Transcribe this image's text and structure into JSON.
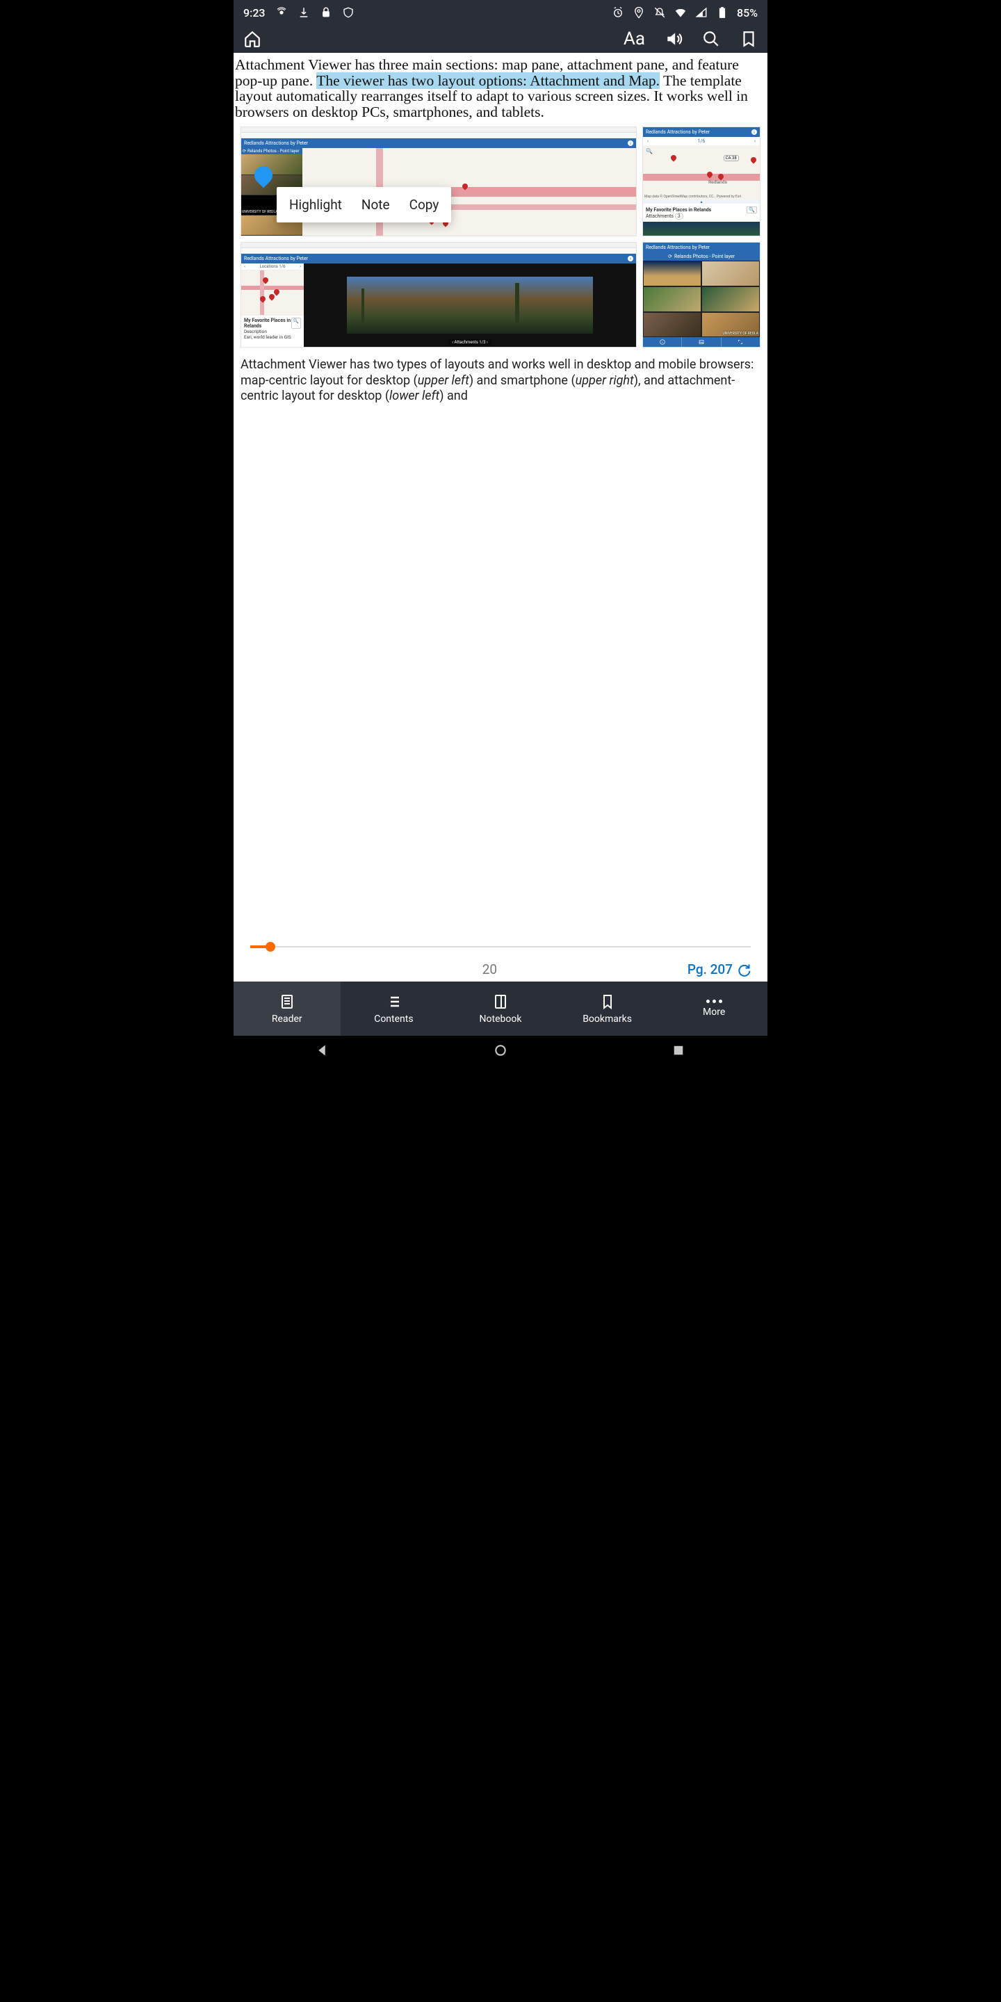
{
  "status_bar": {
    "time": "9:23",
    "battery_pct": "85%"
  },
  "app_header": {
    "font_label": "Aa"
  },
  "reading": {
    "pre_highlight": "Attachment Viewer has three main sections: map pane, attachment pane, and feature pop-up pane. ",
    "highlighted": "The viewer has two layout options: Attachment and Map.",
    "post_highlight": " The template layout automatically rearranges itself to adapt to various screen sizes. It works well in browsers on desktop PCs, smartphones, and tablets."
  },
  "context_menu": {
    "highlight": "Highlight",
    "note": "Note",
    "copy": "Copy"
  },
  "figure": {
    "app_title": "Redlands Attractions by Peter",
    "layer_label": "Relands Photos - Point layer",
    "mobile_counter": "1/6",
    "place_title": "My Favorite Places in Relands",
    "attachments_label": "Attachments",
    "attachments_count": "3",
    "desc_heading": "Description",
    "desc_text": "Esri, world leader in GIS",
    "attachments_footer": "Attachments 1/3",
    "locations_label": "Locations 1/6",
    "map_credit": "Map data © OpenStreetMap contributors, CC… Powered by Esri",
    "route_badge": "CA 38",
    "city_label": "Redlands",
    "univ_label": "UNIVERSITY OF REDLA"
  },
  "caption": {
    "t1": "Attachment Viewer has two types of layouts and works well in desktop and mobile browsers: map-centric layout for desktop (",
    "i1": "upper left",
    "t2": ") and smartphone (",
    "i2": "upper right",
    "t3": "), and attachment-centric layout for desktop (",
    "i3": "lower left",
    "t4": ") and"
  },
  "progress": {
    "percent": "20",
    "page_label": "Pg. 207"
  },
  "bottom_nav": {
    "reader": "Reader",
    "contents": "Contents",
    "notebook": "Notebook",
    "bookmarks": "Bookmarks",
    "more": "More"
  }
}
